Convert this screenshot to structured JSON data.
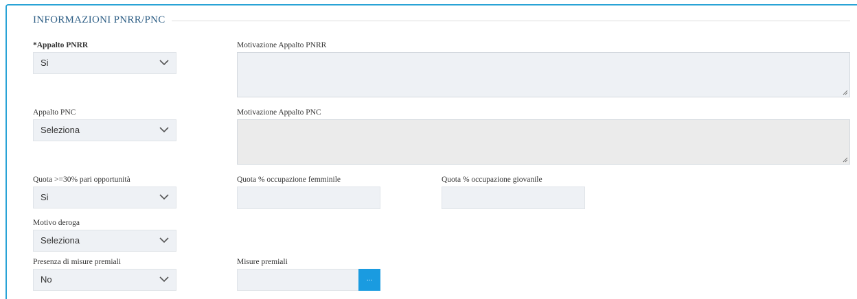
{
  "section": {
    "title": "INFORMAZIONI PNRR/PNC"
  },
  "fields": {
    "appalto_pnrr": {
      "label": "*Appalto PNRR",
      "value": "Si"
    },
    "motivazione_pnrr": {
      "label": "Motivazione Appalto PNRR",
      "value": ""
    },
    "appalto_pnc": {
      "label": "Appalto PNC",
      "value": "Seleziona"
    },
    "motivazione_pnc": {
      "label": "Motivazione Appalto PNC",
      "value": ""
    },
    "quota_pari_opportunita": {
      "label": "Quota >=30% pari opportunità",
      "value": "Si"
    },
    "quota_femminile": {
      "label": "Quota % occupazione femminile",
      "value": ""
    },
    "quota_giovanile": {
      "label": "Quota % occupazione giovanile",
      "value": ""
    },
    "motivo_deroga": {
      "label": "Motivo deroga",
      "value": "Seleziona"
    },
    "presenza_misure_premiali": {
      "label": "Presenza di misure premiali",
      "value": "No"
    },
    "misure_premiali": {
      "label": "Misure premiali",
      "value": "",
      "button_label": "..."
    }
  },
  "colors": {
    "accent": "#1a9be0",
    "frame": "#29a3d6",
    "field_bg": "#eef1f5",
    "disabled_bg": "#ebebeb"
  },
  "icons": {
    "select_arrow": "chevron-down-icon",
    "resize": "resize-grip-icon"
  }
}
